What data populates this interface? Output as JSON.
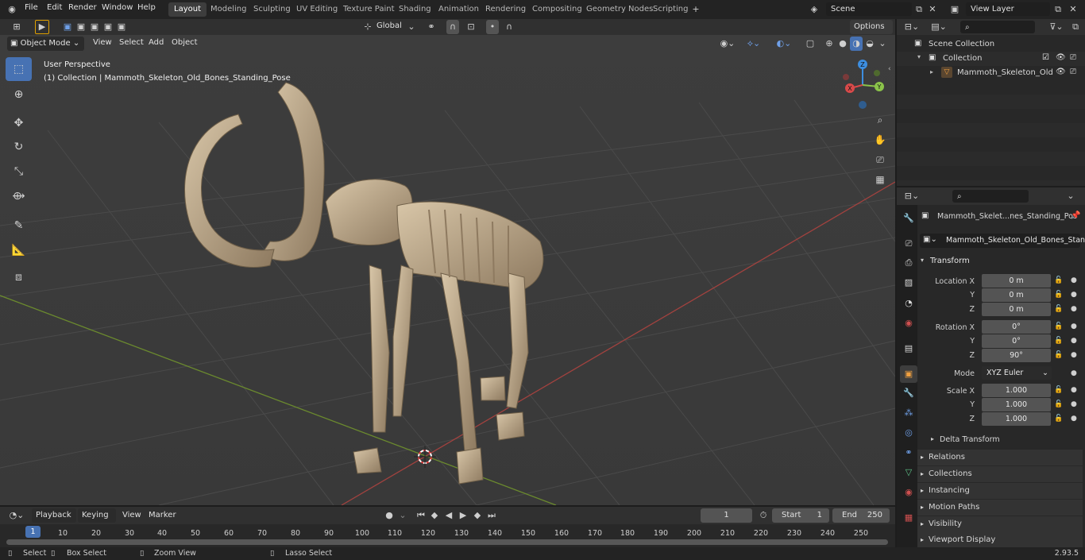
{
  "topbar": {
    "menus": [
      "File",
      "Edit",
      "Render",
      "Window",
      "Help"
    ],
    "workspaces": [
      "Layout",
      "Modeling",
      "Sculpting",
      "UV Editing",
      "Texture Paint",
      "Shading",
      "Animation",
      "Rendering",
      "Compositing",
      "Geometry Nodes",
      "Scripting"
    ],
    "active_workspace": "Layout",
    "scene": "Scene",
    "view_layer": "View Layer"
  },
  "tool_header": {
    "orientation": "Global",
    "options": "Options"
  },
  "viewport_header": {
    "mode": "Object Mode",
    "menus": [
      "View",
      "Select",
      "Add",
      "Object"
    ]
  },
  "viewport": {
    "perspective": "User Perspective",
    "collection_info": "(1) Collection | Mammoth_Skeleton_Old_Bones_Standing_Pose",
    "gizmo": {
      "x": "X",
      "y": "Y",
      "z": "Z"
    }
  },
  "outliner": {
    "scene_collection": "Scene Collection",
    "collection": "Collection",
    "object": "Mammoth_Skeleton_Old"
  },
  "properties": {
    "object_name": "Mammoth_Skelet...nes_Standing_Pos",
    "data_name": "Mammoth_Skeleton_Old_Bones_Standi...",
    "transform_title": "Transform",
    "location_label": "Location X",
    "rotation_label": "Rotation X",
    "scale_label": "Scale X",
    "y_label": "Y",
    "z_label": "Z",
    "location": [
      "0 m",
      "0 m",
      "0 m"
    ],
    "rotation": [
      "0°",
      "0°",
      "90°"
    ],
    "mode_label": "Mode",
    "mode_value": "XYZ Euler",
    "scale": [
      "1.000",
      "1.000",
      "1.000"
    ],
    "delta_transform": "Delta Transform",
    "panels": [
      "Relations",
      "Collections",
      "Instancing",
      "Motion Paths",
      "Visibility",
      "Viewport Display"
    ]
  },
  "timeline": {
    "menus": [
      "Playback",
      "Keying",
      "View",
      "Marker"
    ],
    "current_frame": "1",
    "start_label": "Start",
    "start_value": "1",
    "end_label": "End",
    "end_value": "250",
    "ticks": [
      "1",
      "10",
      "20",
      "30",
      "40",
      "50",
      "60",
      "70",
      "80",
      "90",
      "100",
      "110",
      "120",
      "130",
      "140",
      "150",
      "160",
      "170",
      "180",
      "190",
      "200",
      "210",
      "220",
      "230",
      "240",
      "250"
    ]
  },
  "statusbar": {
    "select": "Select",
    "box_select": "Box Select",
    "zoom_view": "Zoom View",
    "lasso_select": "Lasso Select",
    "version": "2.93.5"
  },
  "colors": {
    "accent": "#4772b3",
    "x_axis": "#d94a4a",
    "y_axis": "#8bc34a",
    "z_axis": "#3d8ee0",
    "bone": "#c2ad8f"
  }
}
